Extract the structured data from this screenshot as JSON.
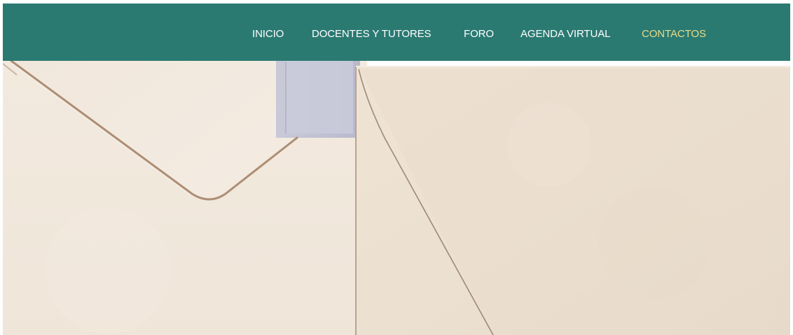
{
  "nav": {
    "items": [
      {
        "label": "INICIO",
        "active": false
      },
      {
        "label": "DOCENTES Y TUTORES",
        "active": false
      },
      {
        "label": "FORO",
        "active": false
      },
      {
        "label": "AGENDA VIRTUAL",
        "active": false
      },
      {
        "label": "CONTACTOS",
        "active": true
      }
    ],
    "background_color": "#2a7a72",
    "active_color": "#e9dc8a"
  },
  "hero": {
    "image": "envelopes-photo"
  }
}
